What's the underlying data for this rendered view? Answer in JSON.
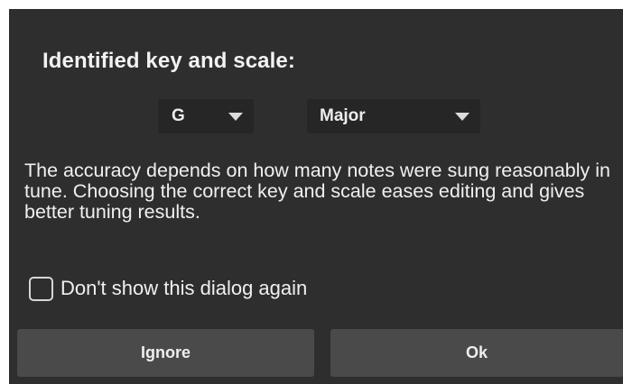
{
  "dialog": {
    "title": "Identified key and scale:",
    "key_select": {
      "value": "G",
      "icon": "chevron-down-icon"
    },
    "scale_select": {
      "value": "Major",
      "icon": "chevron-down-icon"
    },
    "message": "The accuracy depends on how many notes were sung reasonably in tune. Choosing the correct key and scale eases editing and gives better tuning results.",
    "checkbox": {
      "label": "Don't show this dialog again",
      "checked": false
    },
    "buttons": {
      "ignore_label": "Ignore",
      "ok_label": "Ok"
    }
  },
  "colors": {
    "dialog_background": "#2e2e2e",
    "select_background": "#262626",
    "button_background": "#4a4a4a",
    "text": "#f0f0f0"
  }
}
